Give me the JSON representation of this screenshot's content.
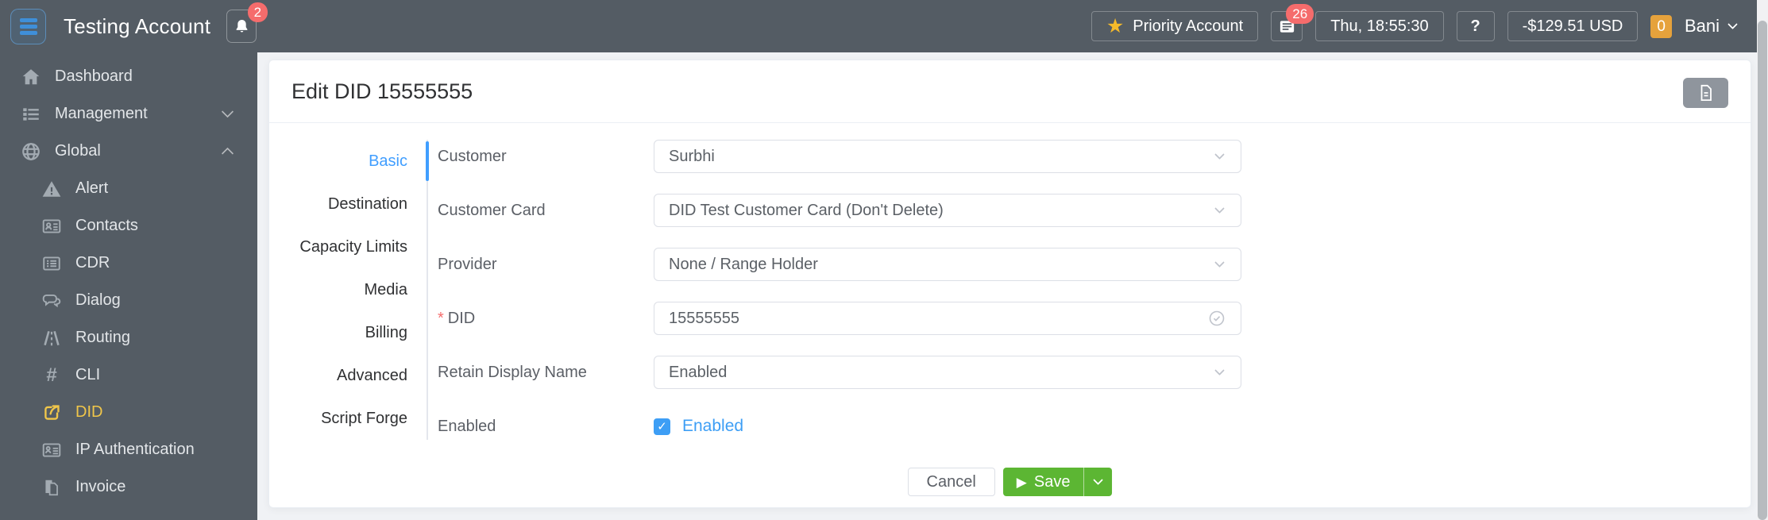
{
  "header": {
    "account_name": "Testing Account",
    "notifications_count": "2",
    "priority_label": "Priority Account",
    "messages_count": "26",
    "datetime": "Thu, 18:55:30",
    "help_label": "?",
    "balance": "-$129.51 USD",
    "counter_badge": "0",
    "user_name": "Bani"
  },
  "sidebar": {
    "items": [
      {
        "label": "Dashboard",
        "icon": "home-icon",
        "level": 1
      },
      {
        "label": "Management",
        "icon": "list-icon",
        "level": 1,
        "chevron": "down"
      },
      {
        "label": "Global",
        "icon": "globe-icon",
        "level": 1,
        "chevron": "up"
      },
      {
        "label": "Alert",
        "icon": "alert-icon",
        "level": 2
      },
      {
        "label": "Contacts",
        "icon": "contacts-icon",
        "level": 2
      },
      {
        "label": "CDR",
        "icon": "cdr-icon",
        "level": 2
      },
      {
        "label": "Dialog",
        "icon": "dialog-icon",
        "level": 2
      },
      {
        "label": "Routing",
        "icon": "routing-icon",
        "level": 2
      },
      {
        "label": "CLI",
        "icon": "hash-icon",
        "level": 2
      },
      {
        "label": "DID",
        "icon": "share-icon",
        "level": 2,
        "active": true
      },
      {
        "label": "IP Authentication",
        "icon": "idcard-icon",
        "level": 2
      },
      {
        "label": "Invoice",
        "icon": "invoice-icon",
        "level": 2
      }
    ]
  },
  "main": {
    "title": "Edit DID 15555555",
    "tabs": [
      {
        "label": "Basic",
        "active": true
      },
      {
        "label": "Destination"
      },
      {
        "label": "Capacity Limits"
      },
      {
        "label": "Media"
      },
      {
        "label": "Billing"
      },
      {
        "label": "Advanced"
      },
      {
        "label": "Script Forge"
      }
    ],
    "form": {
      "fields": [
        {
          "label": "Customer",
          "type": "select",
          "value": "Surbhi"
        },
        {
          "label": "Customer Card",
          "type": "select",
          "value": "DID Test Customer Card (Don't Delete)"
        },
        {
          "label": "Provider",
          "type": "select",
          "value": "None / Range Holder"
        },
        {
          "label": "DID",
          "required": true,
          "type": "text",
          "value": "15555555",
          "trailing_icon": "check-circle-icon"
        },
        {
          "label": "Retain Display Name",
          "type": "select",
          "value": "Enabled"
        },
        {
          "label": "Enabled",
          "type": "checkbox",
          "checked": true,
          "checkbox_label": "Enabled"
        }
      ]
    },
    "actions": {
      "cancel": "Cancel",
      "save": "Save"
    }
  },
  "colors": {
    "header_bg": "#545c64",
    "accent_blue": "#409eff",
    "active_menu_yellow": "#f0c64a",
    "save_green": "#5cb633",
    "danger_red": "#f56c6c",
    "warning_orange": "#e6a23c",
    "star_yellow": "#f5ba2a",
    "page_bg": "#f0f2f5"
  }
}
